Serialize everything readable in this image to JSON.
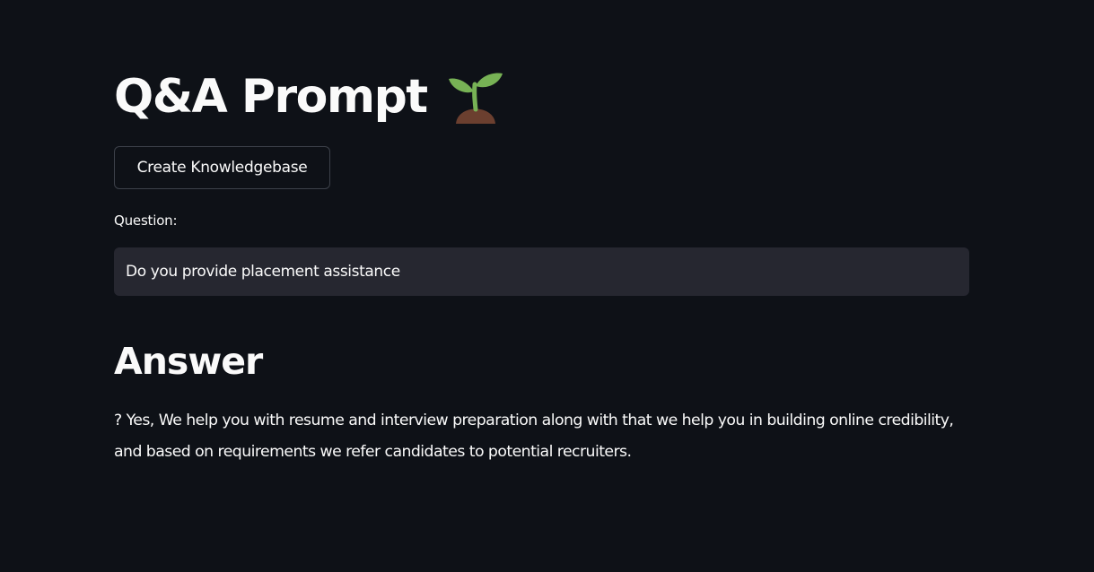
{
  "header": {
    "title": "Q&A Prompt",
    "title_icon": "seedling-icon"
  },
  "actions": {
    "create_button_label": "Create Knowledgebase"
  },
  "question": {
    "label": "Question:",
    "value": "Do you provide placement assistance"
  },
  "answer": {
    "heading": "Answer",
    "text": "? Yes, We help you with resume and interview preparation along with that we help you in building online credibility, and based on requirements we refer candidates to potential recruiters."
  },
  "theme": {
    "background": "#0e1117",
    "text": "#fafafa",
    "input_background": "#262730",
    "button_border": "#3d414a"
  }
}
